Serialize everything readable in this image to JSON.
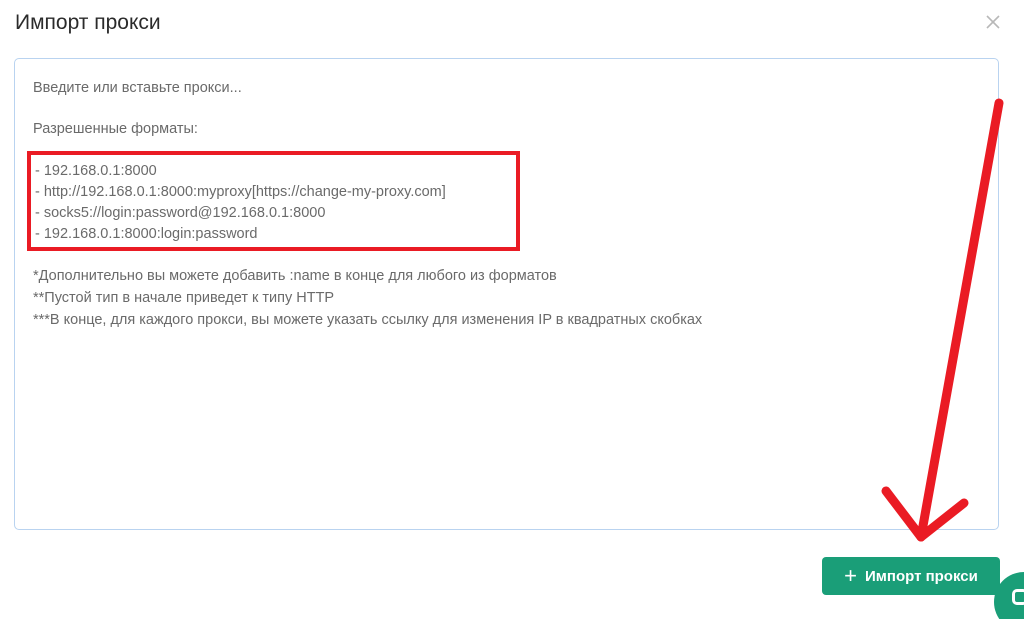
{
  "dialog": {
    "title": "Импорт прокси",
    "close_icon": "close-icon"
  },
  "textarea": {
    "placeholder_lines": [
      "Введите или вставьте прокси...",
      "Разрешенные форматы:",
      "- 192.168.0.1:8000",
      "- http://192.168.0.1:8000:myproxy[https://change-my-proxy.com]",
      "- socks5://login:password@192.168.0.1:8000",
      "- 192.168.0.1:8000:login:password",
      "*Дополнительно вы можете добавить :name в конце для любого из форматов",
      "**Пустой тип в начале приведет к типу HTTP",
      "***В конце, для каждого прокси, вы можете указать ссылку для изменения IP в квадратных скобках"
    ]
  },
  "footer": {
    "import_button_icon": "plus-icon",
    "import_button_label": "Импорт прокси"
  },
  "colors": {
    "accent": "#1a9e78",
    "annotation_red": "#ea1b24",
    "border": "#b9d3f0"
  }
}
